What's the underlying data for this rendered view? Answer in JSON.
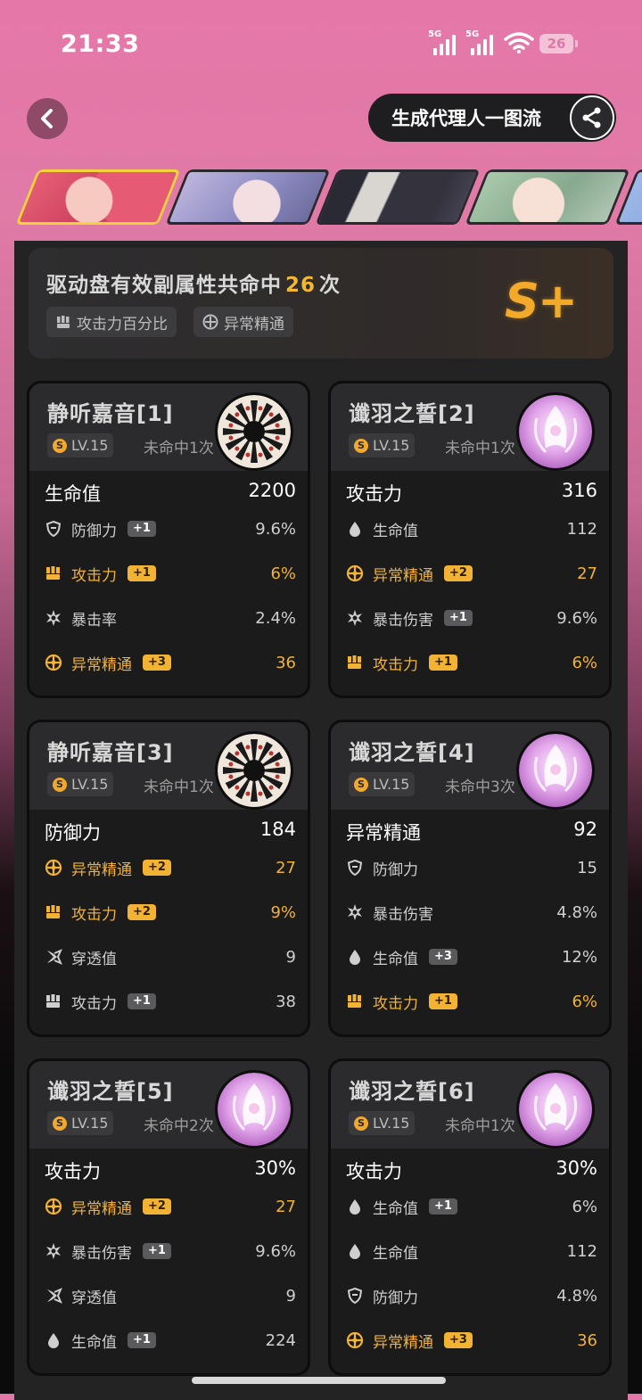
{
  "status_bar": {
    "time": "21:33",
    "network1": "5G",
    "network2": "5G",
    "battery": "26"
  },
  "header": {
    "generate_label": "生成代理人一图流"
  },
  "summary": {
    "text_prefix": "驱动盘有效副属性共命中",
    "count": "26",
    "text_suffix": "次",
    "tags": [
      "攻击力百分比",
      "异常精通"
    ],
    "grade": "S+"
  },
  "colors": {
    "highlight": "#f2b233",
    "card_bg": "#1b1b1c"
  },
  "discs": [
    {
      "name": "静听嘉音[1]",
      "level": "LV.15",
      "miss": "未命中1次",
      "icon": "white-starburst-disc",
      "main": {
        "label": "生命值",
        "value": "2200"
      },
      "subs": [
        {
          "icon": "shield-icon",
          "label": "防御力",
          "badge": "+1",
          "value": "9.6%",
          "hl": false
        },
        {
          "icon": "fist-icon",
          "label": "攻击力",
          "badge": "+1",
          "value": "6%",
          "hl": true
        },
        {
          "icon": "crit-star-icon",
          "label": "暴击率",
          "badge": "",
          "value": "2.4%",
          "hl": false
        },
        {
          "icon": "anomaly-icon",
          "label": "异常精通",
          "badge": "+3",
          "value": "36",
          "hl": true
        }
      ]
    },
    {
      "name": "谶羽之誓[2]",
      "level": "LV.15",
      "miss": "未命中1次",
      "icon": "pink-wing-disc",
      "main": {
        "label": "攻击力",
        "value": "316"
      },
      "subs": [
        {
          "icon": "drop-icon",
          "label": "生命值",
          "badge": "",
          "value": "112",
          "hl": false
        },
        {
          "icon": "anomaly-icon",
          "label": "异常精通",
          "badge": "+2",
          "value": "27",
          "hl": true
        },
        {
          "icon": "crit-star-icon",
          "label": "暴击伤害",
          "badge": "+1",
          "value": "9.6%",
          "hl": false
        },
        {
          "icon": "fist-icon",
          "label": "攻击力",
          "badge": "+1",
          "value": "6%",
          "hl": true
        }
      ]
    },
    {
      "name": "静听嘉音[3]",
      "level": "LV.15",
      "miss": "未命中1次",
      "icon": "white-starburst-disc",
      "main": {
        "label": "防御力",
        "value": "184"
      },
      "subs": [
        {
          "icon": "anomaly-icon",
          "label": "异常精通",
          "badge": "+2",
          "value": "27",
          "hl": true
        },
        {
          "icon": "fist-icon",
          "label": "攻击力",
          "badge": "+2",
          "value": "9%",
          "hl": true
        },
        {
          "icon": "pierce-icon",
          "label": "穿透值",
          "badge": "",
          "value": "9",
          "hl": false
        },
        {
          "icon": "fist-icon",
          "label": "攻击力",
          "badge": "+1",
          "value": "38",
          "hl": false
        }
      ]
    },
    {
      "name": "谶羽之誓[4]",
      "level": "LV.15",
      "miss": "未命中3次",
      "icon": "pink-wing-disc",
      "main": {
        "label": "异常精通",
        "value": "92"
      },
      "subs": [
        {
          "icon": "shield-icon",
          "label": "防御力",
          "badge": "",
          "value": "15",
          "hl": false
        },
        {
          "icon": "crit-star-icon",
          "label": "暴击伤害",
          "badge": "",
          "value": "4.8%",
          "hl": false
        },
        {
          "icon": "drop-icon",
          "label": "生命值",
          "badge": "+3",
          "value": "12%",
          "hl": false
        },
        {
          "icon": "fist-icon",
          "label": "攻击力",
          "badge": "+1",
          "value": "6%",
          "hl": true
        }
      ]
    },
    {
      "name": "谶羽之誓[5]",
      "level": "LV.15",
      "miss": "未命中2次",
      "icon": "pink-wing-disc",
      "main": {
        "label": "攻击力",
        "value": "30%"
      },
      "subs": [
        {
          "icon": "anomaly-icon",
          "label": "异常精通",
          "badge": "+2",
          "value": "27",
          "hl": true
        },
        {
          "icon": "crit-star-icon",
          "label": "暴击伤害",
          "badge": "+1",
          "value": "9.6%",
          "hl": false
        },
        {
          "icon": "pierce-icon",
          "label": "穿透值",
          "badge": "",
          "value": "9",
          "hl": false
        },
        {
          "icon": "drop-icon",
          "label": "生命值",
          "badge": "+1",
          "value": "224",
          "hl": false
        }
      ]
    },
    {
      "name": "谶羽之誓[6]",
      "level": "LV.15",
      "miss": "未命中1次",
      "icon": "pink-wing-disc",
      "main": {
        "label": "攻击力",
        "value": "30%"
      },
      "subs": [
        {
          "icon": "drop-icon",
          "label": "生命值",
          "badge": "+1",
          "value": "6%",
          "hl": false
        },
        {
          "icon": "drop-icon",
          "label": "生命值",
          "badge": "",
          "value": "112",
          "hl": false
        },
        {
          "icon": "shield-icon",
          "label": "防御力",
          "badge": "",
          "value": "4.8%",
          "hl": false
        },
        {
          "icon": "anomaly-icon",
          "label": "异常精通",
          "badge": "+3",
          "value": "36",
          "hl": true
        }
      ]
    }
  ]
}
